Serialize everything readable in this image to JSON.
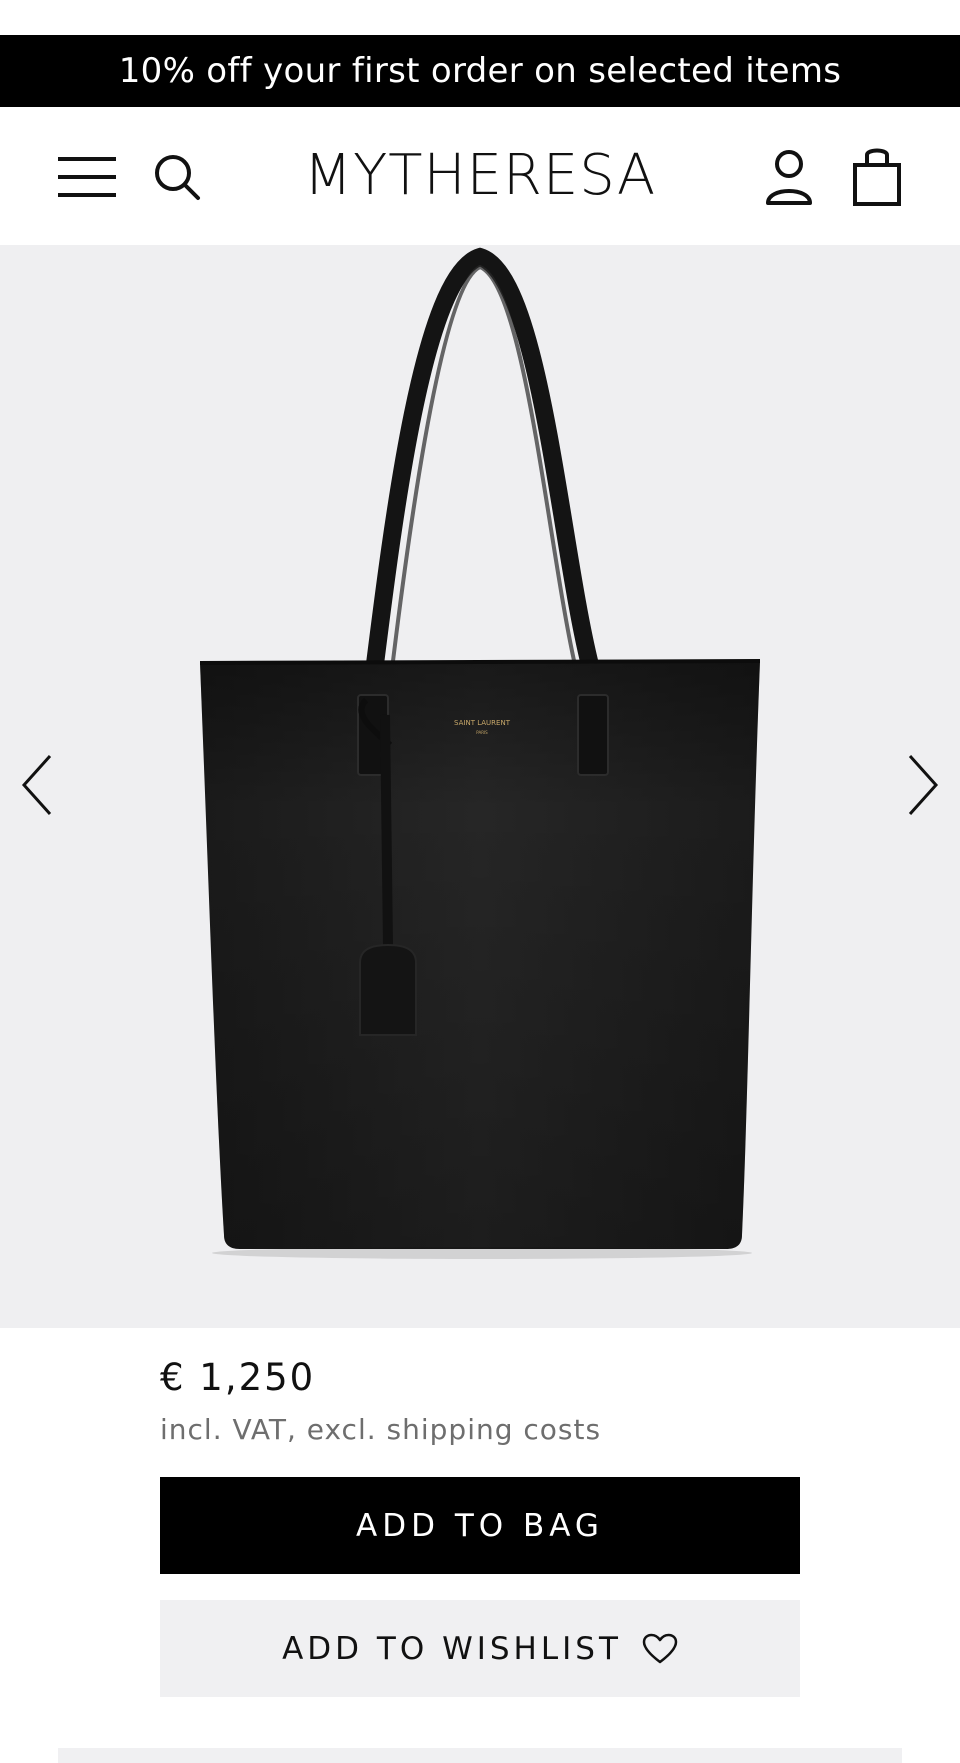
{
  "promo": {
    "text": "10% off your first order on selected items"
  },
  "header": {
    "logo": "MYTHERESA",
    "menu_icon": "hamburger-menu-icon",
    "search_icon": "search-icon",
    "account_icon": "user-icon",
    "bag_icon": "shopping-bag-icon"
  },
  "gallery": {
    "prev_icon": "chevron-left-icon",
    "next_icon": "chevron-right-icon",
    "image": "black leather tote bag",
    "brand_stamp": "SAINT LAURENT PARIS"
  },
  "product": {
    "price": "€ 1,250",
    "vat_note": "incl. VAT, excl. shipping costs"
  },
  "actions": {
    "add_to_bag": "ADD TO BAG",
    "add_to_wishlist": "ADD TO WISHLIST",
    "wishlist_icon": "heart-icon"
  },
  "colors": {
    "promo_bg": "#000000",
    "gallery_bg": "#efeff1",
    "primary_button": "#000000",
    "secondary_button": "#f0f0f2",
    "muted_text": "#6e6e6e"
  }
}
